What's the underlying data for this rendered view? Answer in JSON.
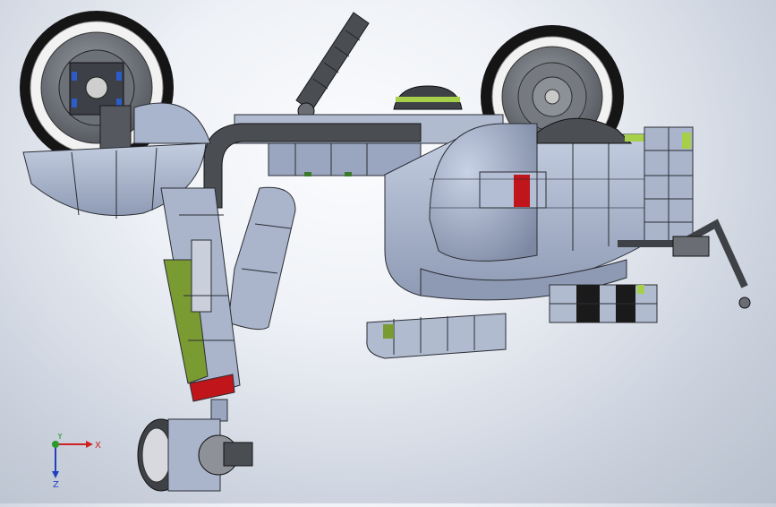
{
  "triad": {
    "x_label": "X",
    "y_label": "Y",
    "z_label": "Z"
  },
  "colors": {
    "background_center": "#fbfcfe",
    "background_edge": "#b8c0cd",
    "body_panel": "#a9b5cc",
    "body_panel_dark": "#8e9ab3",
    "edge_line": "#2a2d34",
    "frame_dark": "#3a3d42",
    "accent_green": "#7a9a32",
    "accent_lime": "#a6d04a",
    "accent_red": "#c0161b",
    "tire_black": "#151515",
    "tire_white": "#f0f0f0",
    "hub_gray": "#6d7177",
    "axis_x": "#d02020",
    "axis_y": "#2a9a2a",
    "axis_z": "#2040c0"
  }
}
